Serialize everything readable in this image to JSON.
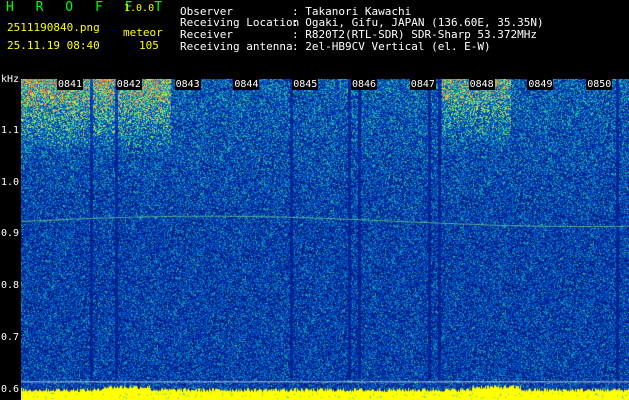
{
  "app": {
    "title": "H R O F F T",
    "version": "1.0.0",
    "filename": "2511190840.png",
    "datetime": "25.11.19 08:40",
    "mode_label": "meteor",
    "count": "105"
  },
  "info": [
    {
      "label": "Observer",
      "value": ": Takanori Kawachi"
    },
    {
      "label": "Receiving Location",
      "value": ": Ogaki, Gifu, JAPAN (136.60E, 35.35N)"
    },
    {
      "label": "Receiver",
      "value": ": R820T2(RTL-SDR) SDR-Sharp 53.372MHz"
    },
    {
      "label": "Receiving antenna",
      "value": ": 2el-HB9CV Vertical (el. E-W)"
    }
  ],
  "axis": {
    "unit": "kHz",
    "yticks": [
      "1.1",
      "1.0",
      "0.9",
      "0.8",
      "0.7",
      "0.6"
    ],
    "yvalues": [
      1.1,
      1.0,
      0.9,
      0.8,
      0.7,
      0.6
    ],
    "ymin": 0.58,
    "ymax": 1.2,
    "xticks": [
      "0841",
      "0842",
      "0843",
      "0844",
      "0845",
      "0846",
      "0847",
      "0848",
      "0849",
      "0850"
    ]
  },
  "colors": {
    "title": "#00ff00",
    "accent": "#ffff00",
    "label": "#ffffff",
    "background": "#000000"
  }
}
